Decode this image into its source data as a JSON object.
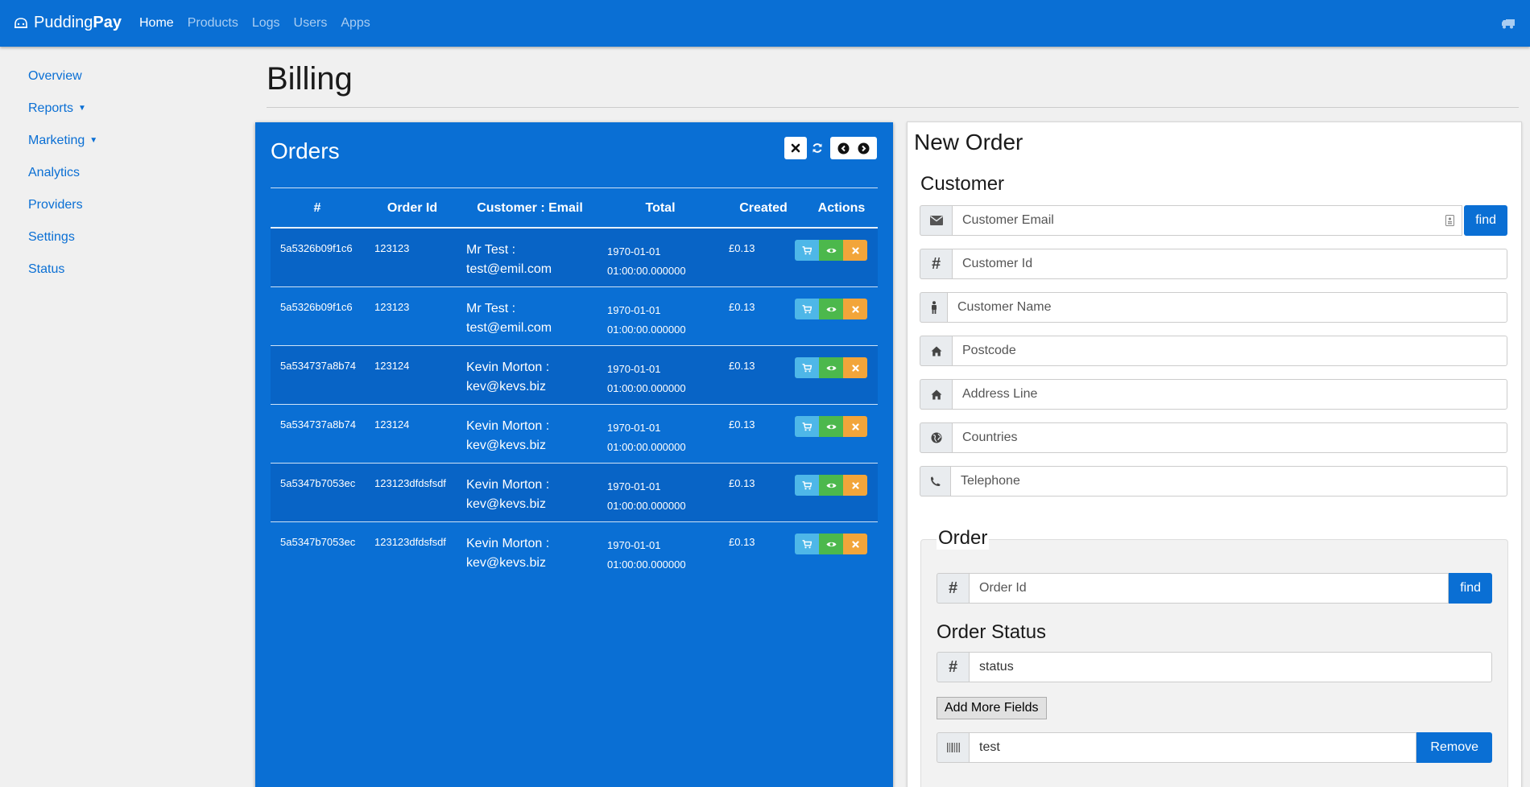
{
  "app": {
    "brand_light": "Pudding",
    "brand_bold": "Pay"
  },
  "nav": {
    "items": [
      "Home",
      "Products",
      "Logs",
      "Users",
      "Apps"
    ],
    "active": "Home"
  },
  "sidebar": {
    "items": [
      {
        "label": "Overview"
      },
      {
        "label": "Reports",
        "caret": "▼"
      },
      {
        "label": "Marketing",
        "caret": "▼"
      },
      {
        "label": "Analytics"
      },
      {
        "label": "Providers"
      },
      {
        "label": "Settings"
      },
      {
        "label": "Status"
      }
    ]
  },
  "page": {
    "title": "Billing"
  },
  "orders": {
    "title": "Orders",
    "columns": [
      "#",
      "Order Id",
      "Customer : Email",
      "Total",
      "Created",
      "Actions"
    ],
    "rows": [
      {
        "hash": "5a5326b09f1c6",
        "order_id": "123123",
        "customer": "Mr Test :",
        "email": "test@emil.com",
        "date": "1970-01-01",
        "time": "01:00:00.000000",
        "total": "£0.13"
      },
      {
        "hash": "5a5326b09f1c6",
        "order_id": "123123",
        "customer": "Mr Test :",
        "email": "test@emil.com",
        "date": "1970-01-01",
        "time": "01:00:00.000000",
        "total": "£0.13"
      },
      {
        "hash": "5a534737a8b74",
        "order_id": "123124",
        "customer": "Kevin Morton :",
        "email": "kev@kevs.biz",
        "date": "1970-01-01",
        "time": "01:00:00.000000",
        "total": "£0.13"
      },
      {
        "hash": "5a534737a8b74",
        "order_id": "123124",
        "customer": "Kevin Morton :",
        "email": "kev@kevs.biz",
        "date": "1970-01-01",
        "time": "01:00:00.000000",
        "total": "£0.13"
      },
      {
        "hash": "5a5347b7053ec",
        "order_id": "123123dfdsfsdf",
        "customer": "Kevin Morton :",
        "email": "kev@kevs.biz",
        "date": "1970-01-01",
        "time": "01:00:00.000000",
        "total": "£0.13"
      },
      {
        "hash": "5a5347b7053ec",
        "order_id": "123123dfdsfsdf",
        "customer": "Kevin Morton :",
        "email": "kev@kevs.biz",
        "date": "1970-01-01",
        "time": "01:00:00.000000",
        "total": "£0.13"
      }
    ]
  },
  "new_order": {
    "title": "New Order",
    "customer_heading": "Customer",
    "fields": {
      "email": {
        "placeholder": "Customer Email",
        "value": ""
      },
      "customer_id": {
        "placeholder": "Customer Id",
        "value": ""
      },
      "customer_name": {
        "placeholder": "Customer Name",
        "value": ""
      },
      "postcode": {
        "placeholder": "Postcode",
        "value": ""
      },
      "address_line": {
        "placeholder": "Address Line",
        "value": ""
      },
      "countries": {
        "placeholder": "Countries",
        "value": ""
      },
      "telephone": {
        "placeholder": "Telephone",
        "value": ""
      }
    },
    "find_label": "find",
    "order_heading": "Order",
    "order_id": {
      "placeholder": "Order Id",
      "value": ""
    },
    "order_find_label": "find",
    "status_heading": "Order Status",
    "status": {
      "placeholder": "status",
      "value": "status"
    },
    "add_more_label": "Add More Fields",
    "extra_field": {
      "value": "test"
    },
    "remove_label": "Remove"
  },
  "colors": {
    "primary": "#0a6fd4",
    "info": "#4eb7e8",
    "success": "#4cb84c",
    "warning": "#f2a53a"
  },
  "icons": [
    "cloud-logo-icon",
    "truck-icon",
    "close-icon",
    "refresh-icon",
    "chevron-left-icon",
    "chevron-right-icon",
    "cart-icon",
    "eye-icon",
    "envelope-icon",
    "hash-icon",
    "person-icon",
    "home-icon",
    "globe-icon",
    "phone-icon",
    "barcode-icon",
    "contact-card-icon"
  ]
}
